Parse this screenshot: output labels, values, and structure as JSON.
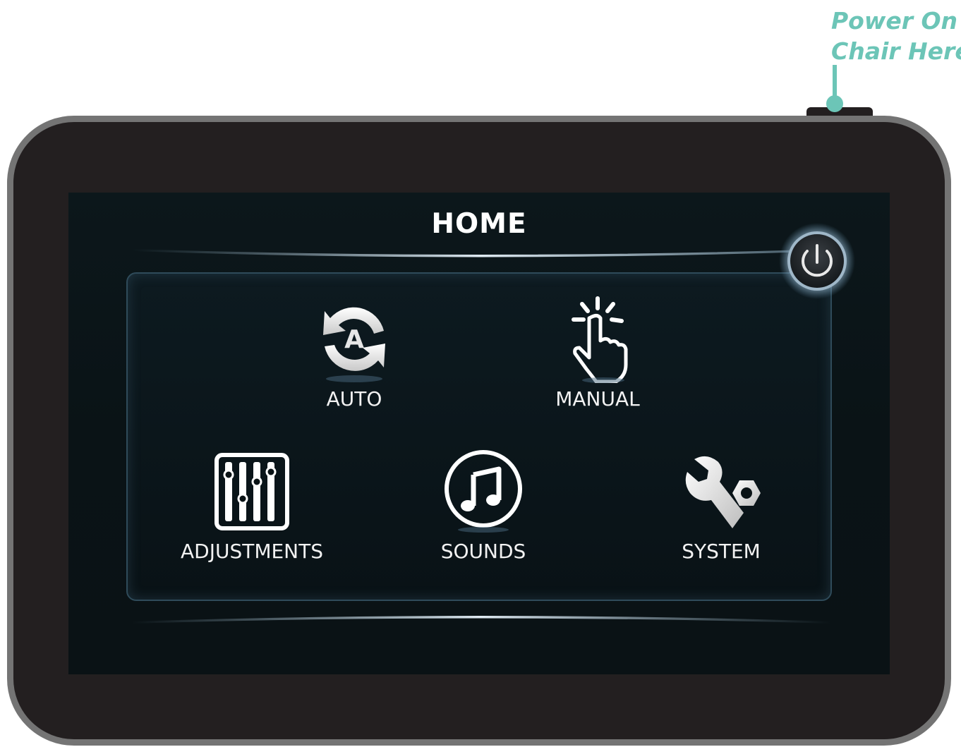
{
  "callout": {
    "line1": "Power On",
    "line2": "Chair Here",
    "color": "#6cc5b7"
  },
  "screen": {
    "title": "HOME",
    "menu": {
      "auto": {
        "label": "AUTO",
        "icon": "auto-cycle-icon"
      },
      "manual": {
        "label": "MANUAL",
        "icon": "tap-hand-icon"
      },
      "adjustments": {
        "label": "ADJUSTMENTS",
        "icon": "sliders-icon"
      },
      "sounds": {
        "label": "SOUNDS",
        "icon": "music-note-icon"
      },
      "system": {
        "label": "SYSTEM",
        "icon": "wrench-nut-icon"
      }
    },
    "power_button": {
      "icon": "power-icon"
    }
  },
  "colors": {
    "device_body": "#231f20",
    "device_bezel": "#747474",
    "screen_bg": "#0a1316",
    "accent": "#6cc5b7"
  }
}
